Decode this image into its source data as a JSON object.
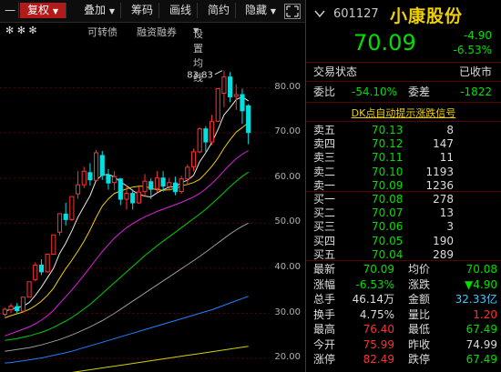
{
  "toolbar": {
    "btn_minus": "—",
    "btn_adjust": "复权",
    "btn_overlay": "叠加",
    "btn_chips": "筹码",
    "btn_draw": "画线",
    "btn_brief": "简约",
    "btn_hide": "隐藏"
  },
  "subbar": {
    "stars": "✻ ✻ ✻",
    "item1": "可转债",
    "item2": "融资融券",
    "item3": "设置均线"
  },
  "chart_data": {
    "type": "candlestick",
    "y_ticks": [
      "80.00",
      "70.00",
      "60.00",
      "50.00",
      "40.00",
      "30.00",
      "20.00"
    ],
    "ylim": [
      17,
      91
    ],
    "high_label": "83.83",
    "candles": [
      [
        29.8,
        30.9,
        29.3,
        31.3
      ],
      [
        30.8,
        31.6,
        30.1,
        32.2
      ],
      [
        31.5,
        30.6,
        29.9,
        32.3
      ],
      [
        30.5,
        33.6,
        30.2,
        33.6
      ],
      [
        33.6,
        37.0,
        33.6,
        37.0
      ],
      [
        37.5,
        40.7,
        37.1,
        41.3
      ],
      [
        40.7,
        39.2,
        38.5,
        42.0
      ],
      [
        39.2,
        43.1,
        39.0,
        43.1
      ],
      [
        43.1,
        47.4,
        43.0,
        47.4
      ],
      [
        48.0,
        52.1,
        47.2,
        52.1
      ],
      [
        52.0,
        50.8,
        49.5,
        54.5
      ],
      [
        50.8,
        55.9,
        50.5,
        55.9
      ],
      [
        56.5,
        58.5,
        55.4,
        61.5
      ],
      [
        58.5,
        61.5,
        57.8,
        62.5
      ],
      [
        61.2,
        59.6,
        58.3,
        63.3
      ],
      [
        59.5,
        65.6,
        59.4,
        66.2
      ],
      [
        65.0,
        60.6,
        59.6,
        66.0
      ],
      [
        60.6,
        58.9,
        57.4,
        62.0
      ],
      [
        59.0,
        60.3,
        57.3,
        61.5
      ],
      [
        59.8,
        55.3,
        54.0,
        60.0
      ],
      [
        55.3,
        56.6,
        53.0,
        58.4
      ],
      [
        56.6,
        54.5,
        53.0,
        57.5
      ],
      [
        54.5,
        56.9,
        54.3,
        58.1
      ],
      [
        57.0,
        59.3,
        56.0,
        60.9
      ],
      [
        59.2,
        57.5,
        55.3,
        59.9
      ],
      [
        57.6,
        60.0,
        56.9,
        61.5
      ],
      [
        60.0,
        58.2,
        57.0,
        61.5
      ],
      [
        58.1,
        59.0,
        57.2,
        60.0
      ],
      [
        58.9,
        57.0,
        56.2,
        60.3
      ],
      [
        57.0,
        59.8,
        56.5,
        60.5
      ],
      [
        59.8,
        62.4,
        58.4,
        63.0
      ],
      [
        62.5,
        65.8,
        61.5,
        66.5
      ],
      [
        65.8,
        70.9,
        65.5,
        71.2
      ],
      [
        70.9,
        68.0,
        65.5,
        71.5
      ],
      [
        68.0,
        72.5,
        67.3,
        74.0
      ],
      [
        72.6,
        79.8,
        72.4,
        79.8
      ],
      [
        78.8,
        82.4,
        75.7,
        83.8
      ],
      [
        82.4,
        78.0,
        76.8,
        83.5
      ],
      [
        78.1,
        78.5,
        75.1,
        80.8
      ],
      [
        78.5,
        74.9,
        72.0,
        79.8
      ],
      [
        76.0,
        70.1,
        67.5,
        76.4
      ]
    ],
    "ma_lines": [
      {
        "color": "#e8e8e8",
        "values": [
          30.5,
          30.9,
          31.3,
          31.6,
          32.4,
          34.0,
          35.8,
          37.9,
          40.0,
          43.3,
          45.6,
          48.3,
          51.3,
          53.7,
          56.1,
          59.5,
          60.7,
          60.8,
          60.3,
          59.1,
          58.3,
          57.2,
          56.4,
          56.0,
          55.8,
          56.7,
          57.4,
          58.0,
          58.1,
          59.0,
          59.5,
          60.6,
          63.6,
          65.6,
          67.9,
          70.7,
          74.0,
          75.6,
          77.4,
          78.0,
          77.1
        ]
      },
      {
        "color": "#f0d000",
        "values": [
          29.0,
          29.5,
          29.9,
          30.3,
          30.9,
          31.7,
          32.7,
          34.0,
          35.6,
          37.8,
          39.9,
          41.8,
          43.8,
          46.0,
          48.5,
          51.3,
          53.8,
          55.4,
          56.6,
          57.1,
          57.6,
          58.0,
          58.2,
          58.2,
          57.7,
          57.4,
          57.3,
          57.4,
          57.7,
          58.2,
          58.6,
          59.0,
          59.7,
          61.1,
          62.6,
          64.4,
          66.6,
          68.5,
          70.2,
          71.2,
          72.3
        ]
      },
      {
        "color": "#e020e0",
        "values": [
          25.0,
          25.5,
          26.0,
          26.5,
          27.0,
          27.7,
          28.5,
          29.5,
          30.7,
          32.2,
          33.7,
          35.2,
          36.8,
          38.5,
          40.2,
          42.0,
          43.7,
          45.2,
          46.7,
          47.9,
          49.0,
          49.9,
          50.7,
          51.4,
          52.0,
          52.6,
          53.1,
          53.6,
          54.1,
          54.6,
          55.2,
          55.8,
          56.6,
          57.6,
          58.8,
          60.1,
          61.6,
          63.0,
          64.3,
          65.3,
          66.1
        ]
      },
      {
        "color": "#00d000",
        "values": [
          24.0,
          24.2,
          24.4,
          24.7,
          25.0,
          25.4,
          25.8,
          26.3,
          26.9,
          27.6,
          28.3,
          29.1,
          30.0,
          31.0,
          32.0,
          33.2,
          34.4,
          35.6,
          36.8,
          38.0,
          39.2,
          40.4,
          41.6,
          42.8,
          43.9,
          45.0,
          46.0,
          47.0,
          48.0,
          49.0,
          50.0,
          51.0,
          52.0,
          53.1,
          54.3,
          55.5,
          56.8,
          58.1,
          59.3,
          60.4,
          61.3
        ]
      },
      {
        "color": "#9a9a9a",
        "values": [
          21.6,
          21.8,
          22.0,
          22.2,
          22.4,
          22.7,
          23.0,
          23.4,
          23.8,
          24.2,
          24.7,
          25.2,
          25.8,
          26.4,
          27.0,
          27.7,
          28.4,
          29.2,
          30.0,
          30.9,
          31.8,
          32.7,
          33.6,
          34.5,
          35.4,
          36.3,
          37.2,
          38.1,
          39.0,
          39.9,
          40.8,
          41.7,
          42.6,
          43.6,
          44.6,
          45.6,
          46.6,
          47.6,
          48.5,
          49.3,
          50.0
        ]
      },
      {
        "color": "#2080ff",
        "values": [
          19.0,
          19.1,
          19.3,
          19.5,
          19.7,
          19.9,
          20.1,
          20.4,
          20.7,
          21.0,
          21.3,
          21.6,
          22.0,
          22.4,
          22.8,
          23.2,
          23.6,
          24.0,
          24.4,
          24.8,
          25.2,
          25.6,
          26.0,
          26.4,
          26.8,
          27.2,
          27.6,
          28.0,
          28.4,
          28.8,
          29.2,
          29.6,
          30.0,
          30.4,
          30.8,
          31.3,
          31.8,
          32.3,
          32.8,
          33.3,
          33.8
        ]
      },
      {
        "color": "#d0d000",
        "values": [
          15.5,
          15.6,
          15.7,
          15.8,
          15.9,
          16.0,
          16.1,
          16.2,
          16.4,
          16.5,
          16.7,
          16.9,
          17.1,
          17.3,
          17.5,
          17.7,
          17.9,
          18.1,
          18.3,
          18.5,
          18.7,
          18.9,
          19.1,
          19.3,
          19.5,
          19.7,
          19.9,
          20.1,
          20.3,
          20.5,
          20.7,
          20.9,
          21.1,
          21.3,
          21.5,
          21.7,
          21.9,
          22.1,
          22.3,
          22.5,
          22.7
        ]
      }
    ]
  },
  "quote": {
    "code": "601127",
    "name": "小康股份",
    "price": "70.09",
    "change": "-4.90",
    "change_pct": "-6.53%",
    "status_label": "交易状态",
    "status_value": "已收市",
    "ratio_label": "委比",
    "ratio_value": "-54.10%",
    "diff_label": "委差",
    "diff_value": "-1822",
    "dk_signal": "DK点自动提示涨跌信号"
  },
  "sells": [
    {
      "label": "卖五",
      "price": "70.13",
      "vol": "8"
    },
    {
      "label": "卖四",
      "price": "70.12",
      "vol": "147"
    },
    {
      "label": "卖三",
      "price": "70.11",
      "vol": "11"
    },
    {
      "label": "卖二",
      "price": "70.10",
      "vol": "1193"
    },
    {
      "label": "卖一",
      "price": "70.09",
      "vol": "1236"
    }
  ],
  "buys": [
    {
      "label": "买一",
      "price": "70.08",
      "vol": "278"
    },
    {
      "label": "买二",
      "price": "70.07",
      "vol": "13"
    },
    {
      "label": "买三",
      "price": "70.06",
      "vol": "3"
    },
    {
      "label": "买四",
      "price": "70.05",
      "vol": "190"
    },
    {
      "label": "买五",
      "price": "70.04",
      "vol": "289"
    }
  ],
  "stats": [
    {
      "l1": "最新",
      "v1": "70.09",
      "c1": "g",
      "l2": "均价",
      "v2": "70.08",
      "c2": "g"
    },
    {
      "l1": "涨幅",
      "v1": "-6.53%",
      "c1": "g",
      "l2": "涨跌",
      "v2": "▼4.90",
      "c2": "g"
    },
    {
      "l1": "总手",
      "v1": "46.14万",
      "c1": "w",
      "l2": "金额",
      "v2": "32.33亿",
      "c2": "c"
    },
    {
      "l1": "换手",
      "v1": "4.75%",
      "c1": "w",
      "l2": "量比",
      "v2": "1.20",
      "c2": "r"
    },
    {
      "l1": "最高",
      "v1": "76.40",
      "c1": "r",
      "l2": "最低",
      "v2": "67.49",
      "c2": "g"
    },
    {
      "l1": "今开",
      "v1": "75.99",
      "c1": "r",
      "l2": "昨收",
      "v2": "74.99",
      "c2": "w"
    },
    {
      "l1": "涨停",
      "v1": "82.49",
      "c1": "r",
      "l2": "跌停",
      "v2": "67.49",
      "c2": "g"
    }
  ]
}
